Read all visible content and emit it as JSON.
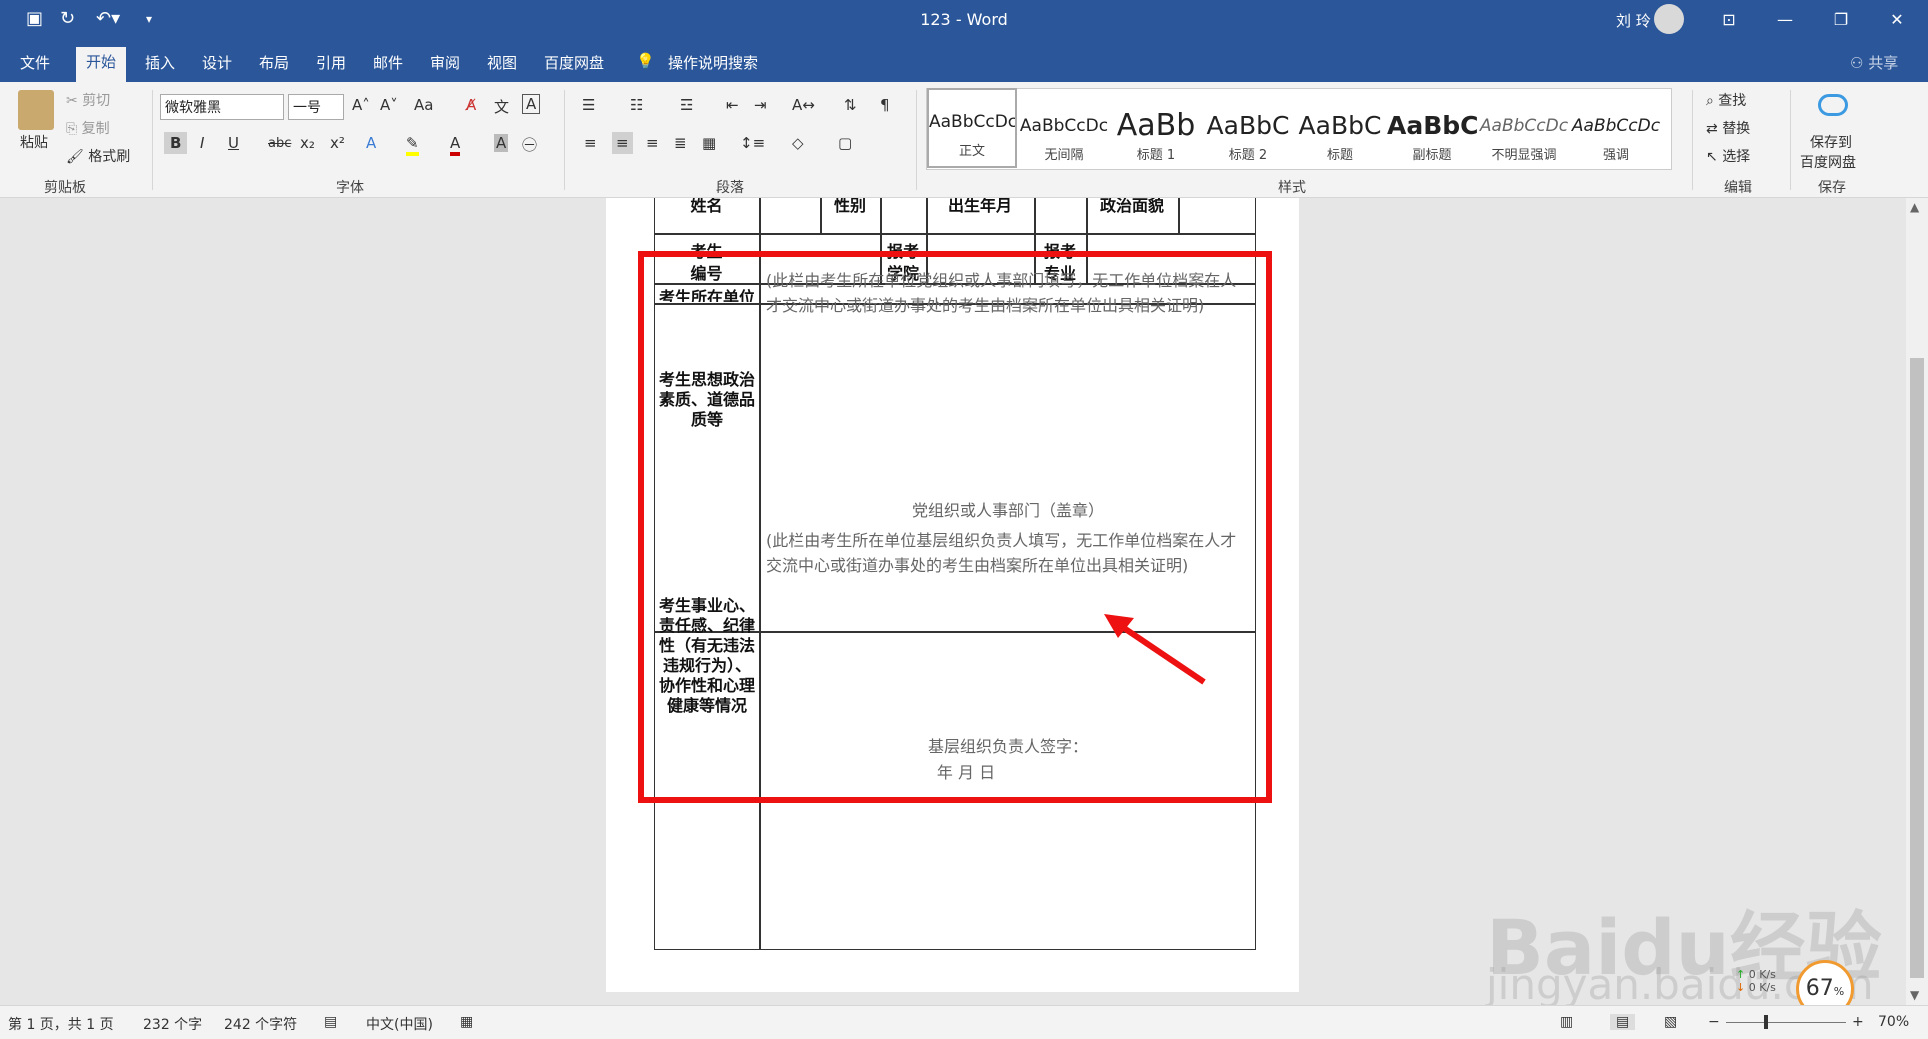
{
  "titlebar": {
    "title": "123 - Word",
    "user": "刘 玲",
    "qat_icons": [
      "save-icon",
      "redo-icon",
      "undo-icon",
      "customize-icon"
    ]
  },
  "tabs": [
    "文件",
    "开始",
    "插入",
    "设计",
    "布局",
    "引用",
    "邮件",
    "审阅",
    "视图",
    "百度网盘"
  ],
  "tell_me": "操作说明搜索",
  "share": "共享",
  "ribbon": {
    "clipboard": {
      "paste": "粘贴",
      "cut": "剪切",
      "copy": "复制",
      "format_painter": "格式刷",
      "label": "剪贴板"
    },
    "font": {
      "family": "微软雅黑",
      "size": "一号",
      "aa": "Aa",
      "label": "字体"
    },
    "paragraph": {
      "label": "段落"
    },
    "styles": {
      "label": "样式",
      "items": [
        {
          "sample": "AaBbCcDc",
          "name": "正文"
        },
        {
          "sample": "AaBbCcDc",
          "name": "无间隔"
        },
        {
          "sample": "AaBb",
          "name": "标题 1"
        },
        {
          "sample": "AaBbC",
          "name": "标题 2"
        },
        {
          "sample": "AaBbC",
          "name": "标题"
        },
        {
          "sample": "AaBbC",
          "name": "副标题"
        },
        {
          "sample": "AaBbCcDc",
          "name": "不明显强调"
        },
        {
          "sample": "AaBbCcDc",
          "name": "强调"
        }
      ]
    },
    "editing": {
      "find": "查找",
      "replace": "替换",
      "select": "选择",
      "label": "编辑"
    },
    "save": {
      "line1": "保存到",
      "line2": "百度网盘",
      "label": "保存"
    }
  },
  "document": {
    "row1": {
      "name": "姓名",
      "gender": "性别",
      "birth": "出生年月",
      "political": "政治面貌"
    },
    "row2": {
      "exam_no_1": "考生",
      "exam_no_2": "编号",
      "school_1": "报考",
      "school_2": "学院",
      "major_1": "报考",
      "major_2": "专业"
    },
    "row3": {
      "unit": "考生所在单位"
    },
    "section1": {
      "label": "考生思想政治素质、道德品质等",
      "note": "(此栏由考生所在单位党组织或人事部门填写，无工作单位档案在人才交流中心或街道办事处的考生由档案所在单位出具相关证明)",
      "footer": "党组织或人事部门（盖章）"
    },
    "section2": {
      "label": "考生事业心、责任感、纪律性（有无违法违规行为）、协作性和心理健康等情况",
      "note": "(此栏由考生所在单位基层组织负责人填写，无工作单位档案在人才 交流中心或街道办事处的考生由档案所在单位出具相关证明)",
      "signature": "基层组织负责人签字：",
      "date": "年 月 日"
    }
  },
  "statusbar": {
    "page": "第 1 页，共 1 页",
    "words": "232 个字",
    "chars": "242 个字符",
    "lang": "中文(中国)",
    "zoom": "70%"
  },
  "overlay": {
    "badge": "67",
    "badge_unit": "%",
    "up_speed": "0",
    "down_speed": "0",
    "speed_unit": "K/s",
    "watermark": "Baidu经验",
    "watermark_url": "jingyan.baidu.com"
  }
}
